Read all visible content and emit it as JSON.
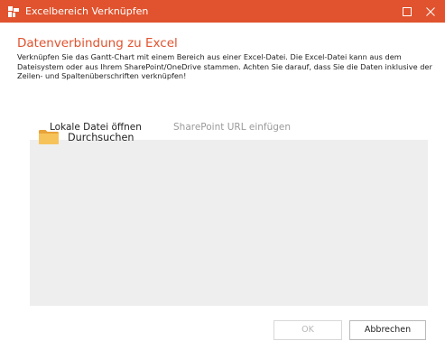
{
  "window": {
    "title": "Excelbereich Verknüpfen",
    "accent_color": "#e0532e",
    "controls": {
      "maximize": "maximize-icon",
      "close": "close-icon"
    }
  },
  "dialog": {
    "heading": "Datenverbindung zu Excel",
    "description": "Verknüpfen Sie das Gantt-Chart mit einem Bereich aus einer Excel-Datei. Die Excel-Datei kann aus dem Dateisystem oder aus Ihrem SharePoint/OneDrive stammen. Achten Sie darauf, dass Sie die Daten inklusive der Zeilen- und Spaltenüberschriften verknüpfen!"
  },
  "tabs": [
    {
      "label": "Lokale Datei öffnen",
      "active": true
    },
    {
      "label": "SharePoint URL einfügen",
      "active": false
    }
  ],
  "browse": {
    "label": "Durchsuchen",
    "icon": "folder-icon"
  },
  "buttons": {
    "ok": {
      "label": "OK",
      "enabled": false
    },
    "cancel": {
      "label": "Abbrechen",
      "enabled": true
    }
  }
}
